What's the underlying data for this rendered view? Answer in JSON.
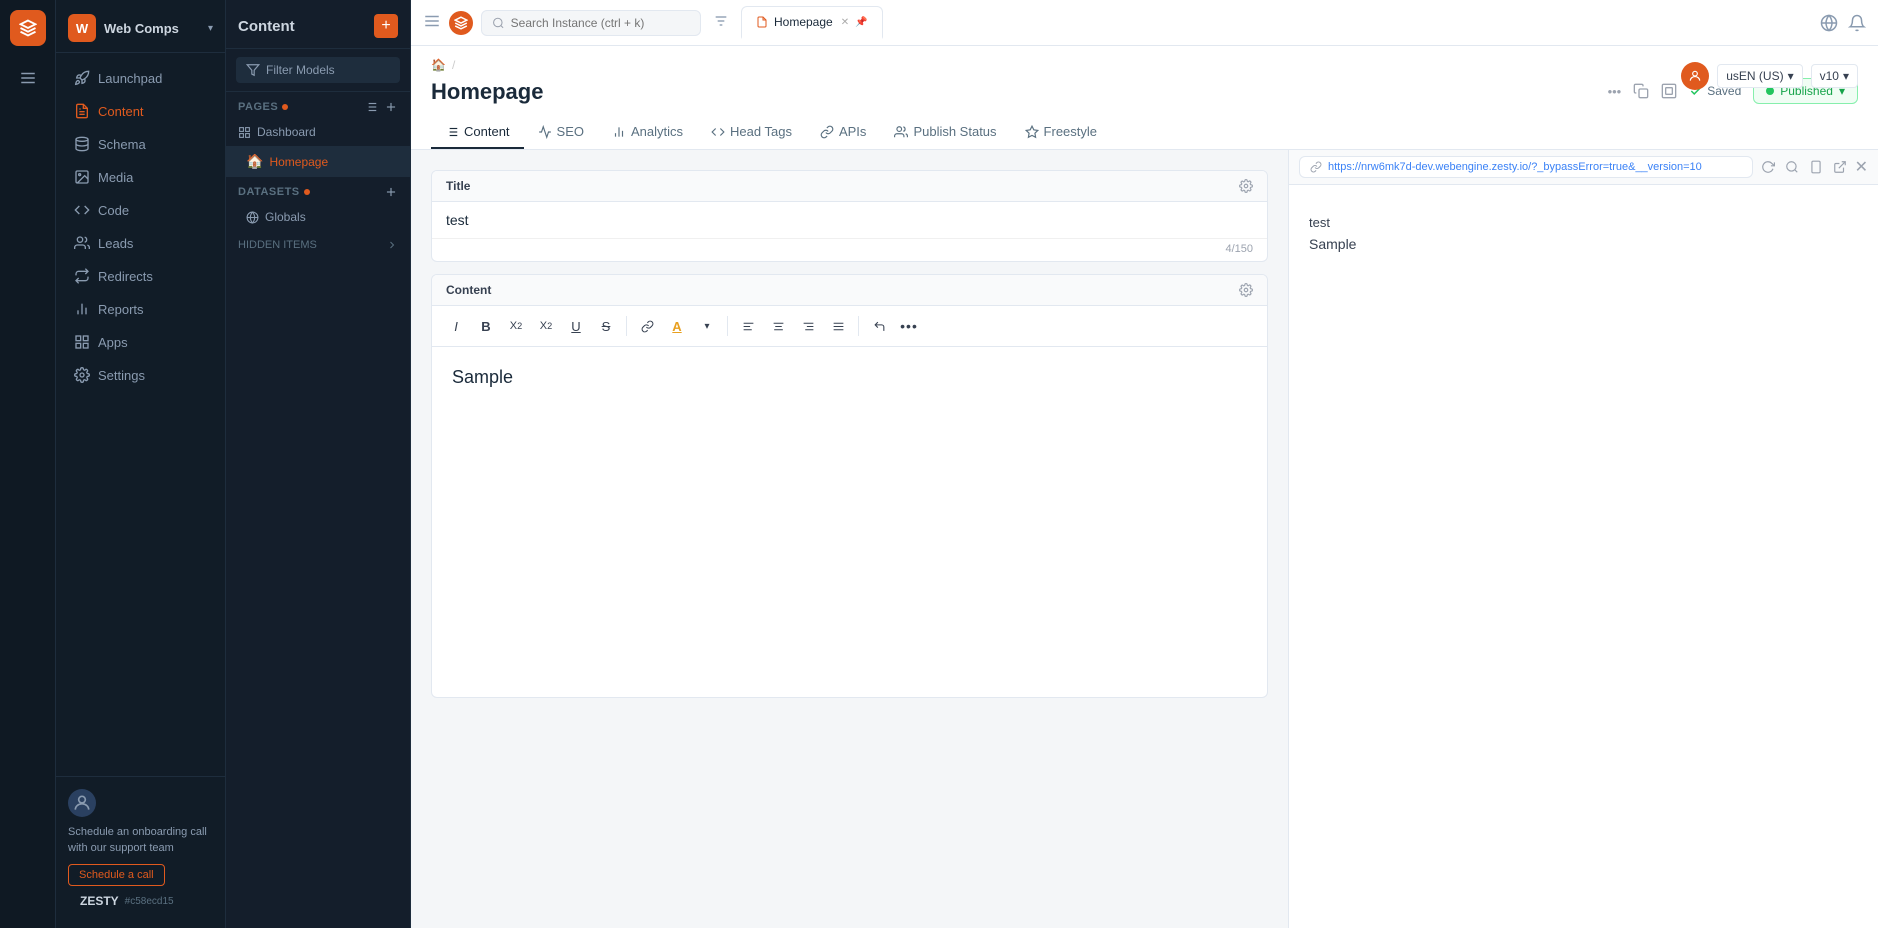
{
  "app": {
    "title": "Web Comps",
    "instance_id": "#c58ecd15"
  },
  "topbar": {
    "search_placeholder": "Search Instance (ctrl + k)",
    "tab_label": "Homepage",
    "menu_icon": "☰"
  },
  "sidebar": {
    "logo_letter": "W",
    "title": "Web Comps",
    "nav_items": [
      {
        "id": "launchpad",
        "label": "Launchpad",
        "icon": "rocket"
      },
      {
        "id": "content",
        "label": "Content",
        "icon": "file-text",
        "active": true
      },
      {
        "id": "schema",
        "label": "Schema",
        "icon": "database"
      },
      {
        "id": "media",
        "label": "Media",
        "icon": "image"
      },
      {
        "id": "code",
        "label": "Code",
        "icon": "code"
      },
      {
        "id": "leads",
        "label": "Leads",
        "icon": "users"
      },
      {
        "id": "redirects",
        "label": "Redirects",
        "icon": "arrow-right"
      },
      {
        "id": "reports",
        "label": "Reports",
        "icon": "bar-chart"
      },
      {
        "id": "apps",
        "label": "Apps",
        "icon": "grid"
      },
      {
        "id": "settings",
        "label": "Settings",
        "icon": "gear"
      }
    ],
    "footer": {
      "schedule_text": "Schedule an onboarding call with our support team",
      "schedule_btn": "Schedule a call"
    },
    "zesty_logo": "ZESTY",
    "instance_hash": "#c58ecd15"
  },
  "content_panel": {
    "title": "Content",
    "add_btn": "+",
    "filter_btn": "Filter Models",
    "pages_section": "PAGES",
    "pages_badge": true,
    "dashboard_item": "Dashboard",
    "homepage_item": "Homepage",
    "datasets_section": "DATASETS",
    "globals_item": "Globals",
    "hidden_section": "HIDDEN ITEMS"
  },
  "page": {
    "breadcrumb_home": "🏠",
    "breadcrumb_sep": "/",
    "title": "Homepage",
    "tabs": [
      {
        "id": "content",
        "label": "Content",
        "icon": "list",
        "active": true
      },
      {
        "id": "seo",
        "label": "SEO",
        "icon": "chart"
      },
      {
        "id": "analytics",
        "label": "Analytics",
        "icon": "bar"
      },
      {
        "id": "head-tags",
        "label": "Head Tags",
        "icon": "code"
      },
      {
        "id": "apis",
        "label": "APIs",
        "icon": "link"
      },
      {
        "id": "publish-status",
        "label": "Publish Status",
        "icon": "users"
      },
      {
        "id": "freestyle",
        "label": "Freestyle",
        "icon": "flag"
      }
    ],
    "actions": {
      "more_icon": "•••",
      "copy_icon": "⧉",
      "frame_icon": "▣",
      "saved_label": "Saved",
      "published_label": "Published",
      "chevron": "▾"
    },
    "version": "v10",
    "locale": "usEN (US)"
  },
  "editor": {
    "title_field": {
      "label": "Title",
      "value": "test",
      "char_count": "4/150"
    },
    "content_field": {
      "label": "Content",
      "value": "Sample",
      "toolbar": {
        "italic": "I",
        "bold": "B",
        "subscript": "X₂",
        "superscript": "X²",
        "underline": "U",
        "strikethrough": "S",
        "link": "🔗",
        "highlight": "A",
        "align_left": "≡",
        "align_center": "≡",
        "align_right": "≡",
        "justify": "≡",
        "undo": "↩",
        "more": "•••"
      }
    }
  },
  "preview": {
    "url": "https://nrw6mk7d-dev.webengine.zesty.io/?_bypassError=true&__version=10",
    "content_lines": [
      {
        "text": "test"
      },
      {
        "text": "Sample"
      }
    ]
  }
}
